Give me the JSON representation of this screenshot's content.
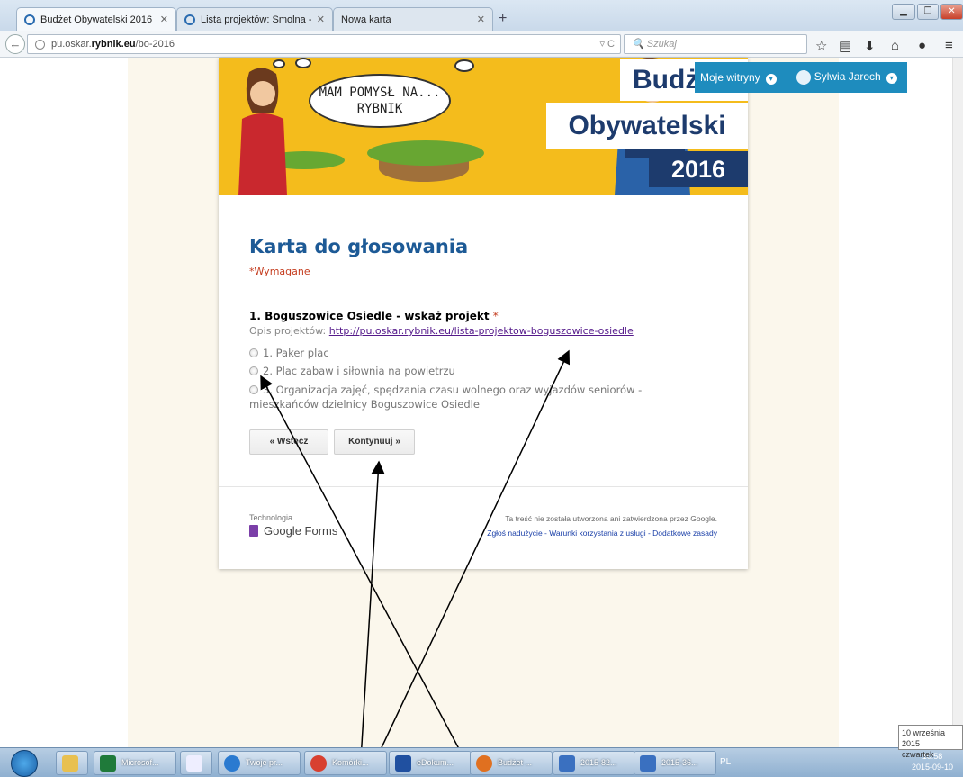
{
  "browser": {
    "tabs": [
      {
        "title": "Budżet Obywatelski 2016 - ...",
        "active": true
      },
      {
        "title": "Lista projektów: Smolna - ...",
        "active": false
      },
      {
        "title": "Nowa karta",
        "active": false
      }
    ],
    "new_tab": "+",
    "url_prefix": "pu.oskar.",
    "url_domain": "rybnik.eu",
    "url_path": "/bo-2016",
    "search_placeholder": "Szukaj"
  },
  "wp_admin": {
    "sites": "Moje witryny",
    "user": "Sylwia Jaroch"
  },
  "banner": {
    "speech": "MAM POMYSŁ NA...",
    "speech2": "RYBNIK",
    "line1": "Budżet",
    "line2": "Obywatelski",
    "line3": "2016"
  },
  "form": {
    "title": "Karta do głosowania",
    "required": "*Wymagane",
    "question": "1. Boguszowice Osiedle - wskaż projekt",
    "question_marker": "*",
    "desc_label": "Opis projektów:",
    "desc_link": "http://pu.oskar.rybnik.eu/lista-projektow-boguszowice-osiedle",
    "options": [
      "1. Paker plac",
      "2. Plac zabaw i siłownia na powietrzu",
      "3. Organizacja zajęć, spędzania czasu wolnego oraz wyjazdów seniorów - mieszkańców dzielnicy Boguszowice Osiedle"
    ],
    "back_button": "« Wstecz",
    "next_button": "Kontynuuj »"
  },
  "footer": {
    "tech_label": "Technologia",
    "brand": "Google Forms",
    "disclaimer": "Ta treść nie została utworzona ani zatwierdzona przez Google.",
    "links": "Zgłoś nadużycie - Warunki korzystania z usługi - Dodatkowe zasady"
  },
  "taskbar": {
    "items": [
      "Microsof...",
      "",
      "Twoje pr...",
      "Komórki...",
      "eDokum...",
      "Budżet ...",
      "2015-82...",
      "2015-36..."
    ],
    "lang": "PL",
    "tooltip_date": "10 września 2015",
    "tooltip_day": "czwartek",
    "time": "10:58",
    "date": "2015-09-10"
  },
  "colors": {
    "title_blue": "#1d5a96",
    "required_red": "#c43b1d",
    "banner_yellow": "#f4bc1c",
    "navy": "#1d3b6d",
    "wp_blue": "#1e8cbe"
  }
}
